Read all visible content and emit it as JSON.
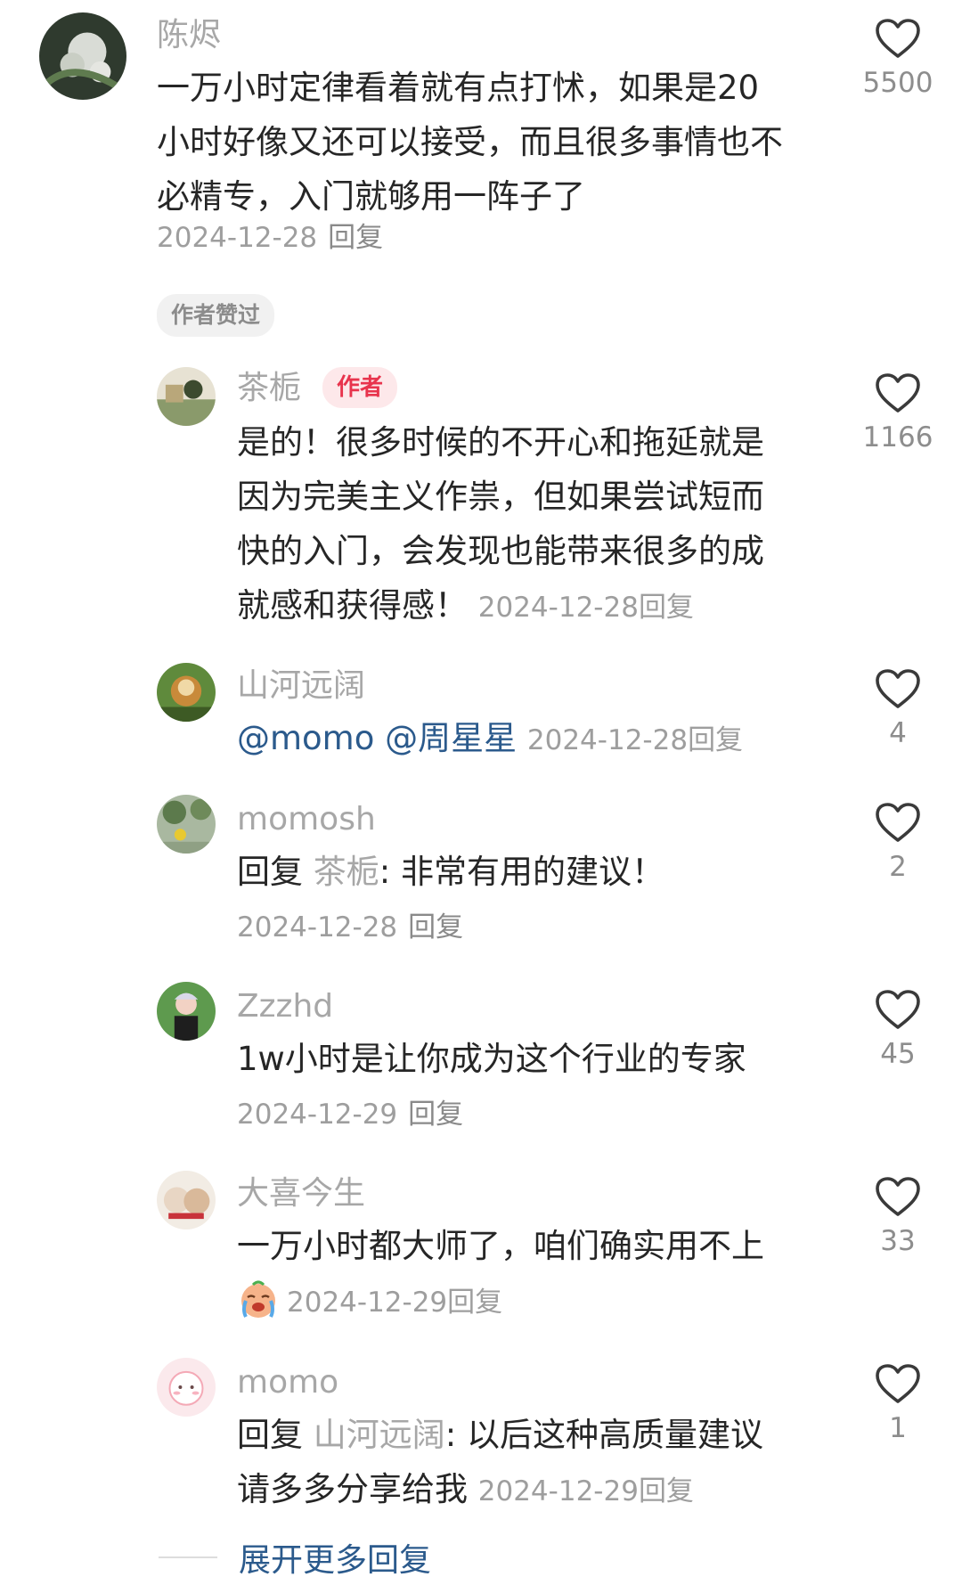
{
  "comments": {
    "c0": {
      "user": "陈烬",
      "lines": [
        "一万小时定律看着就有点打怵，如果是20",
        "小时好像又还可以接受，而且很多事情也不",
        "必精专，入门就够用一阵子了"
      ],
      "date": "2024-12-28",
      "reply": "回复",
      "likes": "5500",
      "badge": "作者赞过"
    },
    "c1": {
      "user": "茶栀",
      "tag": "作者",
      "lines": [
        "是的！很多时候的不开心和拖延就是",
        "因为完美主义作祟，但如果尝试短而",
        "快的入门，会发现也能带来很多的成",
        "就感和获得感！"
      ],
      "date": "2024-12-28",
      "reply": "回复",
      "likes": "1166"
    },
    "c2": {
      "user": "山河远阔",
      "mention1": "@momo",
      "mention2": "@周星星",
      "date": "2024-12-28",
      "reply": "回复",
      "likes": "4"
    },
    "c3": {
      "user": "momosh",
      "prefix": "回复",
      "quote": "茶栀",
      "rest": ": 非常有用的建议！",
      "date": "2024-12-28",
      "reply": "回复",
      "likes": "2"
    },
    "c4": {
      "user": "Zzzhd",
      "text": "1w小时是让你成为这个行业的专家",
      "date": "2024-12-29",
      "reply": "回复",
      "likes": "45"
    },
    "c5": {
      "user": "大喜今生",
      "text": "一万小时都大师了，咱们确实用不上",
      "emoji": "crying-face-emoji",
      "date": "2024-12-29",
      "reply": "回复",
      "likes": "33"
    },
    "c6": {
      "user": "momo",
      "prefix": "回复",
      "quote": "山河远阔",
      "rest": ": 以后这种高质量建议",
      "line2": "请多多分享给我",
      "date": "2024-12-29",
      "reply": "回复",
      "likes": "1"
    }
  },
  "expand_label": "展开更多回复",
  "colors": {
    "author_tag": "#e8344d",
    "link": "#2b5a8c",
    "muted": "#a7a7a7"
  }
}
